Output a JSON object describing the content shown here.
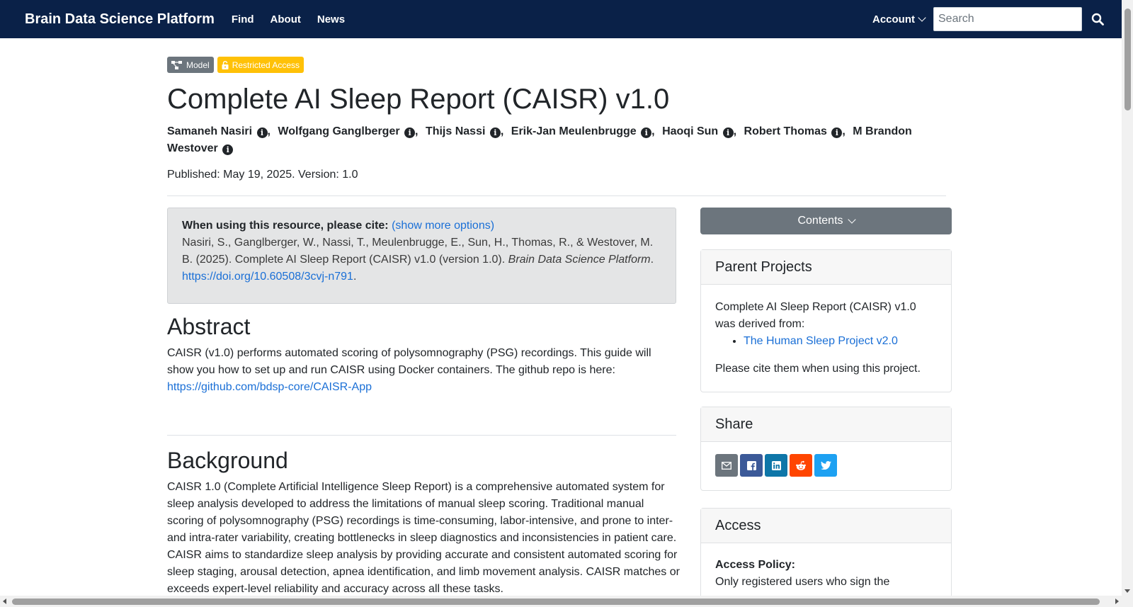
{
  "nav": {
    "brand": "Brain Data Science Platform",
    "links": [
      "Find",
      "About",
      "News"
    ],
    "account": "Account",
    "search_placeholder": "Search"
  },
  "badges": {
    "model": "Model",
    "restricted": "Restricted Access"
  },
  "title": "Complete AI Sleep Report (CAISR) v1.0",
  "authors": [
    "Samaneh Nasiri",
    "Wolfgang Ganglberger",
    "Thijs Nassi",
    "Erik-Jan Meulenbrugge",
    "Haoqi Sun",
    "Robert Thomas",
    "M Brandon Westover"
  ],
  "published": "Published: May 19, 2025. Version: 1.0",
  "citation": {
    "lead": "When using this resource, please cite:",
    "more": "(show more options)",
    "text_1": "Nasiri, S., Ganglberger, W., Nassi, T., Meulenbrugge, E., Sun, H., Thomas, R., & Westover, M. B. (2025). Complete AI Sleep Report (CAISR) v1.0 (version 1.0). ",
    "journal": "Brain Data Science Platform",
    "text_2": ".",
    "doi": "https://doi.org/10.60508/3cvj-n791",
    "text_3": "."
  },
  "abstract": {
    "heading": "Abstract",
    "text": "CAISR (v1.0) performs automated scoring of polysomnography (PSG) recordings. This guide will show you how to set up and run CAISR using Docker containers. The github repo is here: ",
    "link": "https://github.com/bdsp-core/CAISR-App"
  },
  "background": {
    "heading": "Background",
    "text": "CAISR 1.0 (Complete Artificial Intelligence Sleep Report) is a comprehensive automated system for sleep analysis developed to address the limitations of manual sleep scoring. Traditional manual scoring of polysomnography (PSG) recordings is time-consuming, labor-intensive, and prone to inter- and intra-rater variability, creating bottlenecks in sleep diagnostics and inconsistencies in patient care. CAISR aims to standardize sleep analysis by providing accurate and consistent automated scoring for sleep staging, arousal detection, apnea identification, and limb movement analysis. CAISR matches or exceeds expert-level reliability and accuracy across all these tasks."
  },
  "sidebar": {
    "contents": "Contents",
    "parent": {
      "heading": "Parent Projects",
      "text": "Complete AI Sleep Report (CAISR) v1.0 was derived from:",
      "link": "The Human Sleep Project v2.0",
      "footer": "Please cite them when using this project."
    },
    "share": {
      "heading": "Share",
      "colors": {
        "email": "#6c757d",
        "facebook": "#3b5998",
        "linkedin": "#0e76a8",
        "reddit": "#ff4500",
        "twitter": "#1da1f2"
      }
    },
    "access": {
      "heading": "Access",
      "policy_label": "Access Policy:",
      "policy_text": "Only registered users who sign the"
    }
  }
}
